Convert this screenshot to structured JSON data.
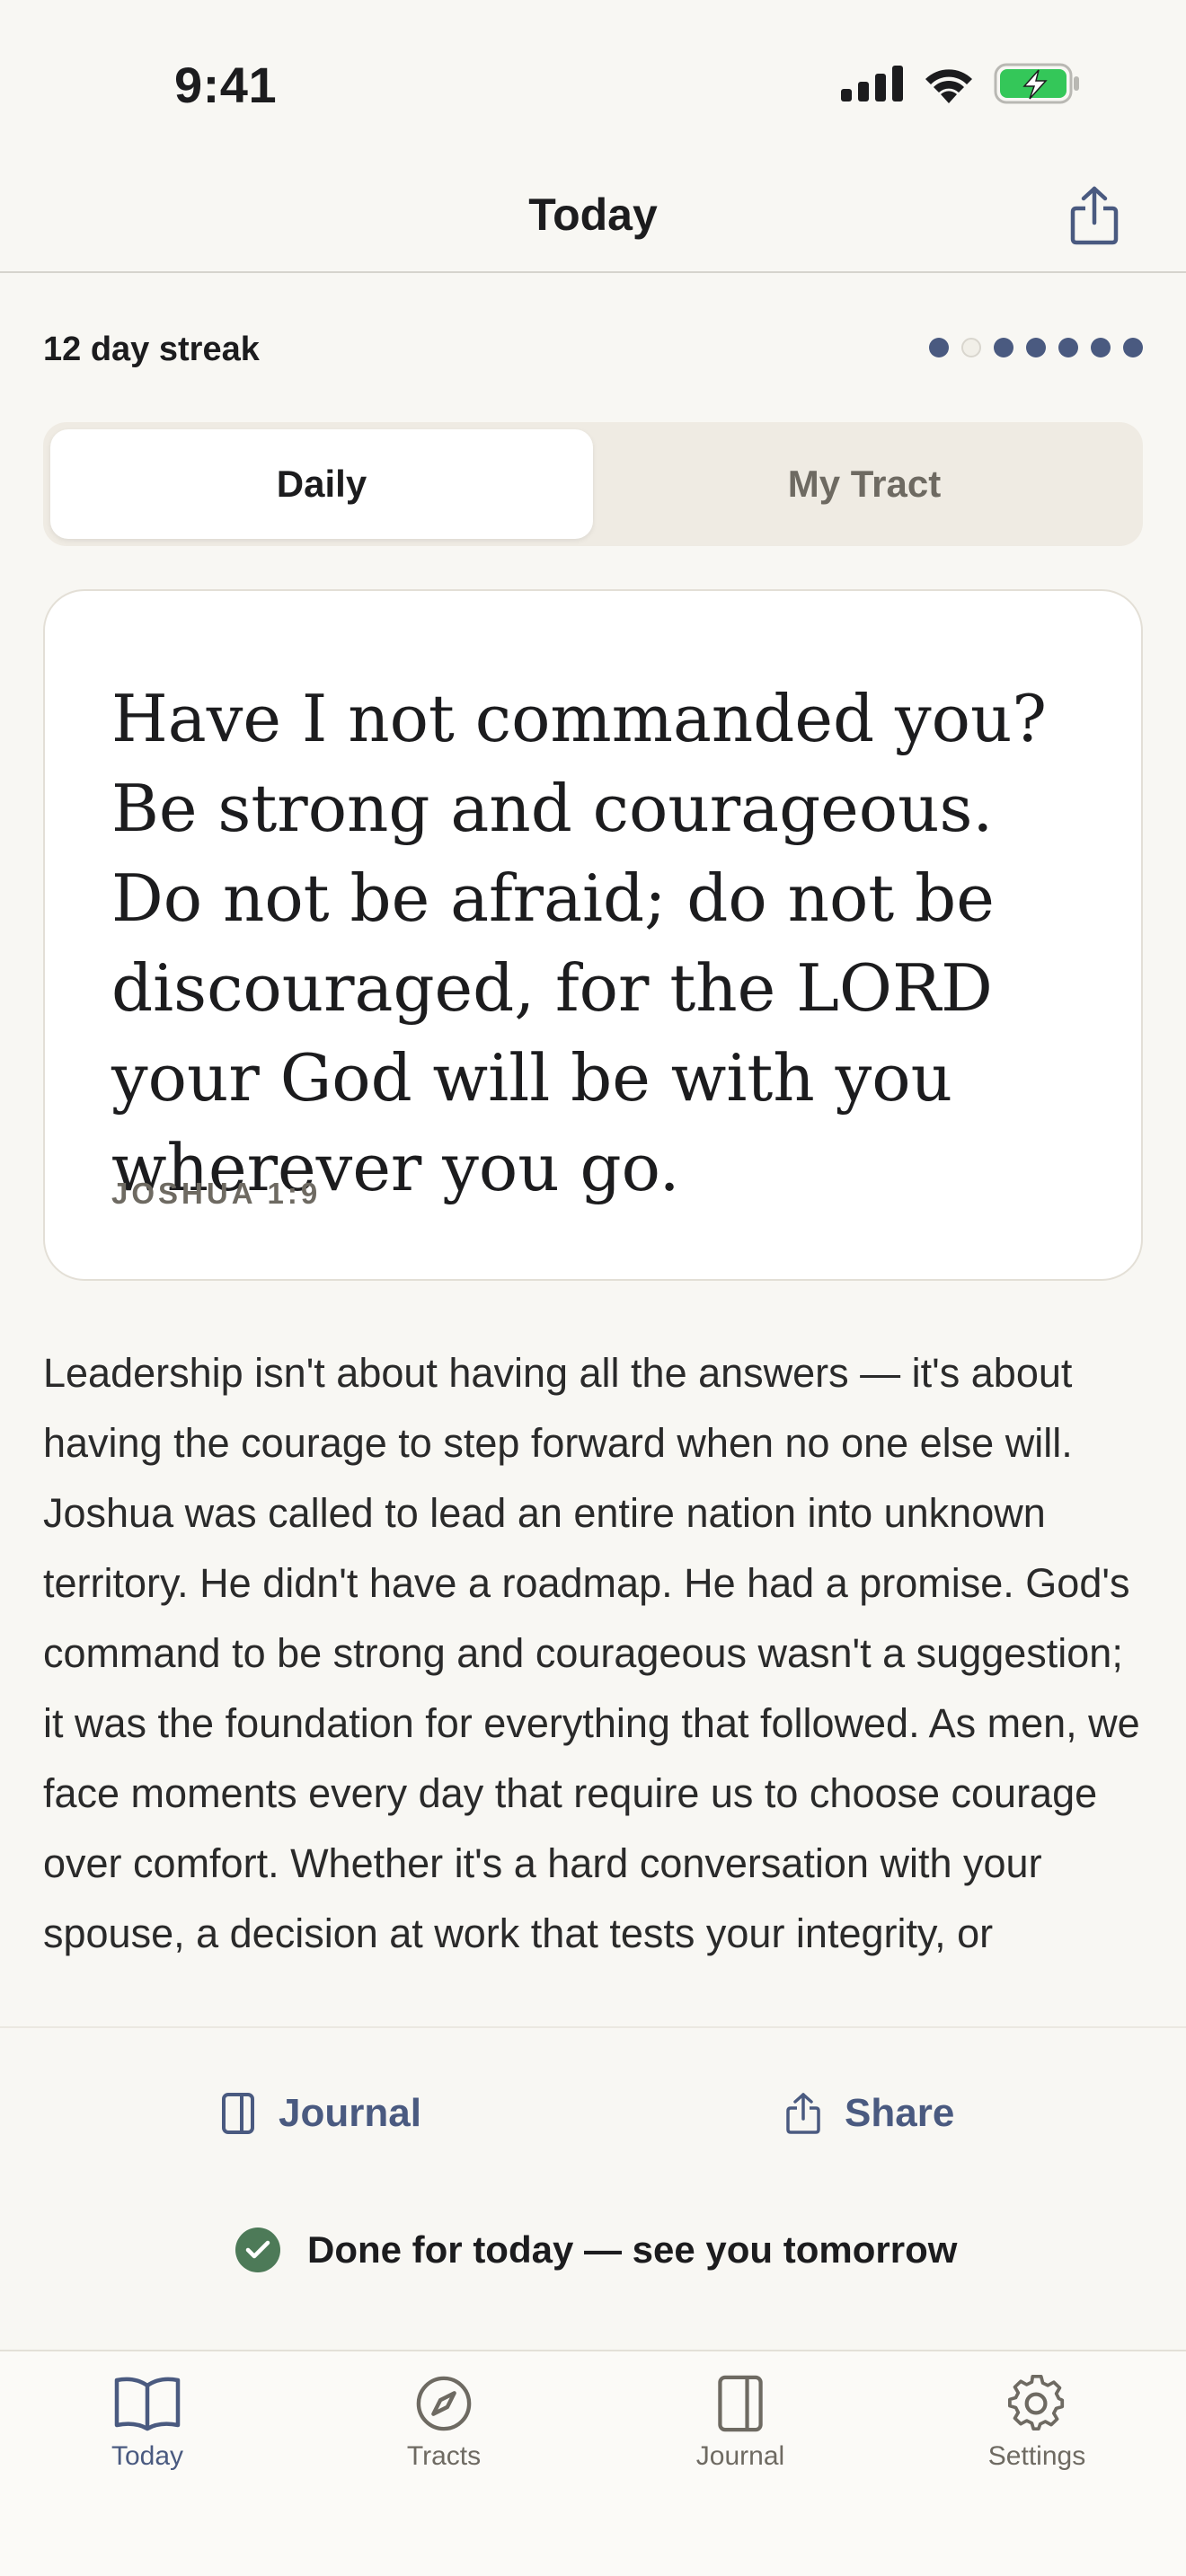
{
  "status_bar": {
    "time": "9:41"
  },
  "nav": {
    "title": "Today"
  },
  "streak": {
    "label": "12 day streak",
    "dots_total": 7,
    "dots_filled": [
      true,
      false,
      true,
      true,
      true,
      true,
      true
    ]
  },
  "segmented": {
    "daily_label": "Daily",
    "tract_label": "My Tract",
    "selected": "Daily"
  },
  "verse": {
    "text": "Have I not commanded you? Be strong and courageous. Do not be afraid; do not be discouraged, for the LORD your God will be with you wherever you go.",
    "reference": "JOSHUA 1:9"
  },
  "reflection": {
    "text": "Leadership isn't about having all the answers — it's about having the courage to step forward when no one else will. Joshua was called to lead an entire nation into unknown territory. He didn't have a roadmap. He had a promise. God's command to be strong and courageous wasn't a suggestion; it was the foundation for everything that followed. As men, we face moments every day that require us to choose courage over comfort. Whether it's a hard conversation with your spouse, a decision at work that tests your integrity, or"
  },
  "actions": {
    "journal_label": "Journal",
    "share_label": "Share"
  },
  "done": {
    "label": "Done for today — see you tomorrow"
  },
  "tabs": [
    {
      "label": "Today",
      "icon": "book-open-icon",
      "active": true
    },
    {
      "label": "Tracts",
      "icon": "compass-icon",
      "active": false
    },
    {
      "label": "Journal",
      "icon": "journal-icon",
      "active": false
    },
    {
      "label": "Settings",
      "icon": "gear-icon",
      "active": false
    }
  ],
  "colors": {
    "accent": "#4a5a80",
    "success": "#4d7a58",
    "background": "#f8f7f3",
    "battery": "#34c759"
  }
}
